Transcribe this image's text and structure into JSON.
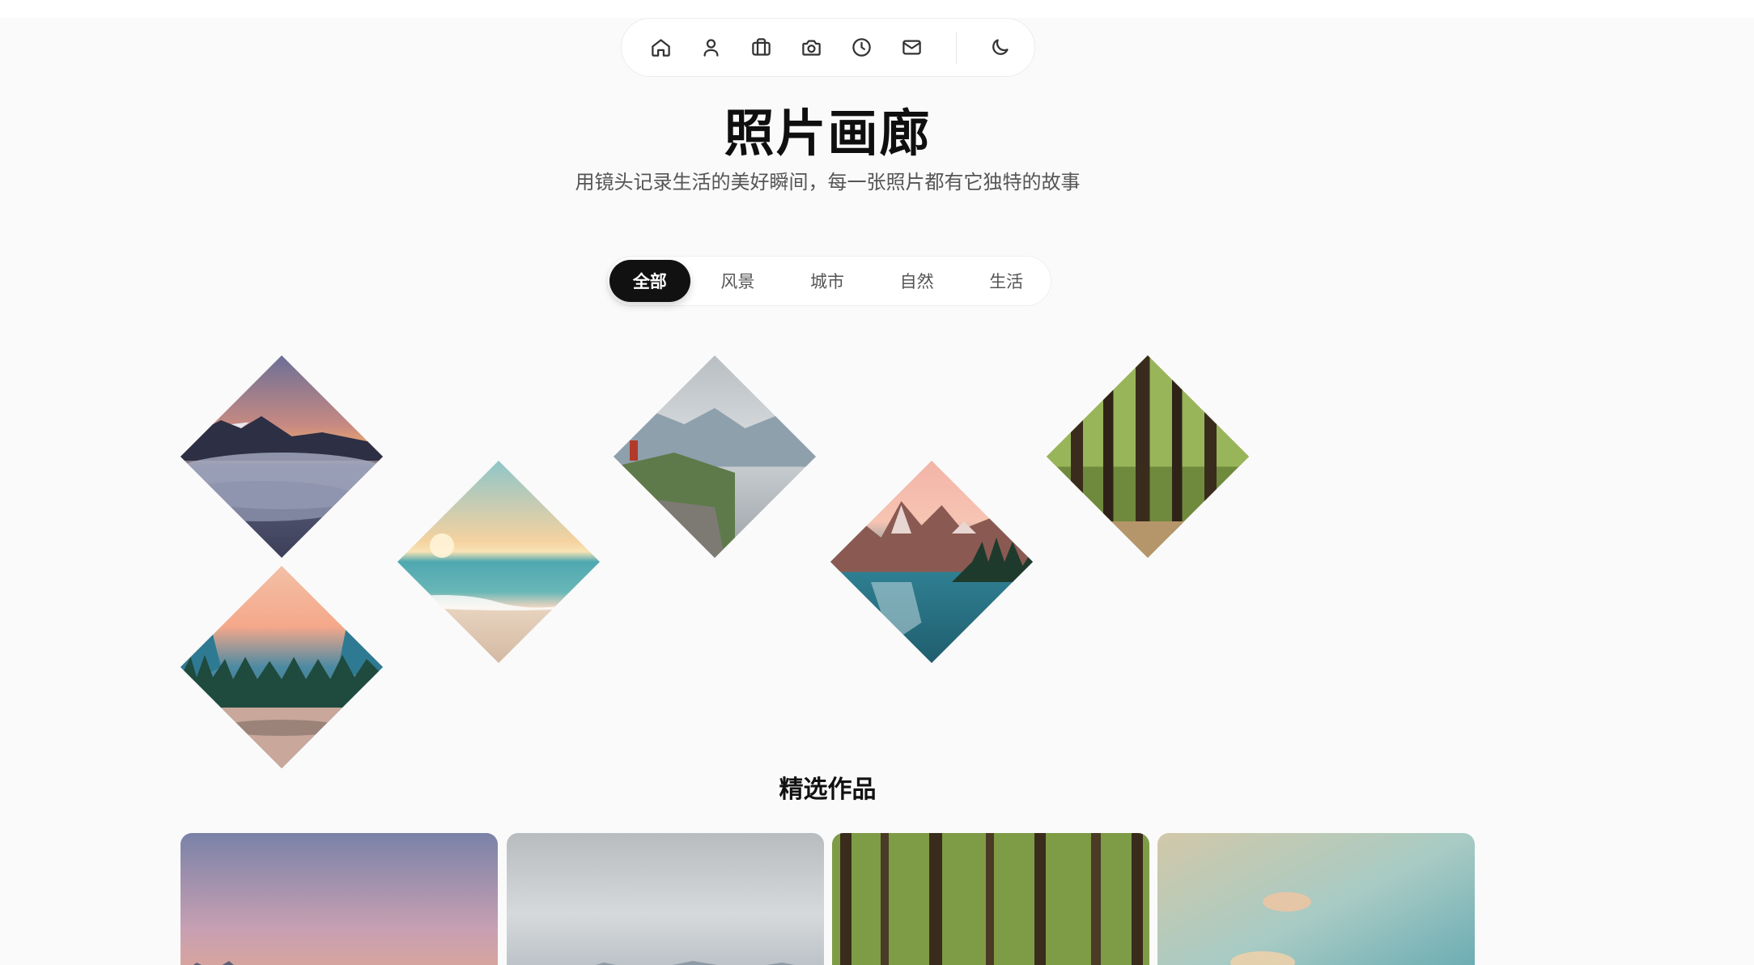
{
  "nav": {
    "items": [
      {
        "icon": "home-icon"
      },
      {
        "icon": "user-icon"
      },
      {
        "icon": "briefcase-icon"
      },
      {
        "icon": "camera-icon"
      },
      {
        "icon": "clock-icon"
      },
      {
        "icon": "mail-icon"
      }
    ],
    "theme_toggle_icon": "moon-icon"
  },
  "header": {
    "title": "照片画廊",
    "subtitle": "用镜头记录生活的美好瞬间，每一张照片都有它独特的故事"
  },
  "filters": {
    "items": [
      "全部",
      "风景",
      "城市",
      "自然",
      "生活"
    ],
    "active": "全部"
  },
  "gallery": {
    "photos": [
      {
        "subject": "mountain-sea-of-clouds-sunset"
      },
      {
        "subject": "beach-sunset"
      },
      {
        "subject": "hiker-mountain-ridge"
      },
      {
        "subject": "mountain-lake-reflection"
      },
      {
        "subject": "forest-trees"
      },
      {
        "subject": "valley-forest-river"
      }
    ]
  },
  "featured": {
    "title": "精选作品",
    "cards": [
      {
        "subject": "mountain-sunset"
      },
      {
        "subject": "cloudy-mountains"
      },
      {
        "subject": "forest"
      },
      {
        "subject": "beach-sky"
      }
    ]
  },
  "colors": {
    "background": "#fafafa",
    "active_filter": "#111111",
    "text_primary": "#0f0f0f",
    "text_secondary": "#555555"
  }
}
